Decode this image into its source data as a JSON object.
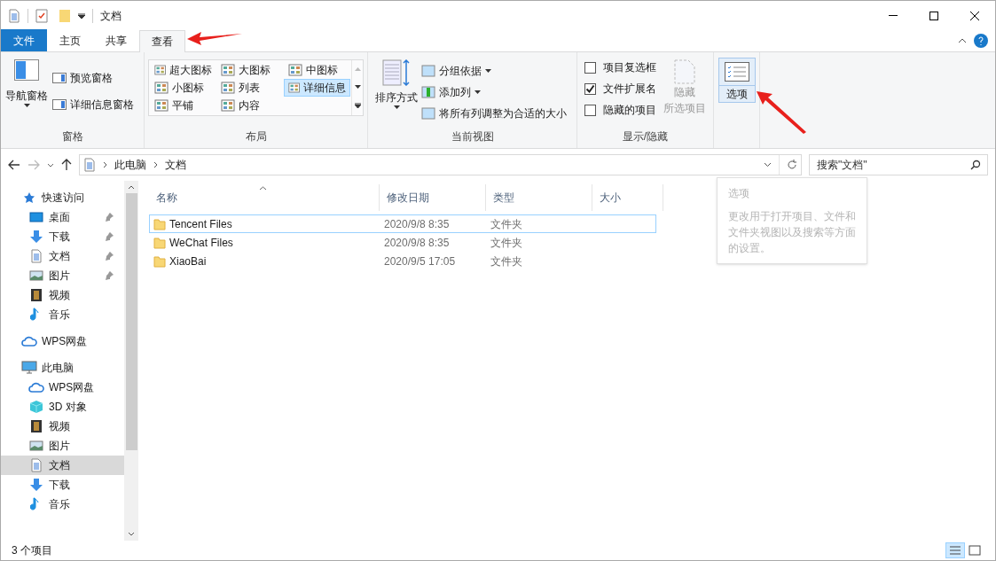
{
  "window": {
    "title": "文档"
  },
  "tabs": [
    {
      "label": "文件",
      "kind": "file",
      "selected": false
    },
    {
      "label": "主页",
      "kind": "tab",
      "selected": false
    },
    {
      "label": "共享",
      "kind": "tab",
      "selected": false
    },
    {
      "label": "查看",
      "kind": "tab",
      "selected": true
    }
  ],
  "ribbon": {
    "pane": {
      "label": "窗格",
      "nav_pane": "导航窗格",
      "items": [
        "预览窗格",
        "详细信息窗格"
      ]
    },
    "layout": {
      "label": "布局",
      "options": [
        {
          "label": "超大图标",
          "selected": false
        },
        {
          "label": "大图标",
          "selected": false
        },
        {
          "label": "中图标",
          "selected": false
        },
        {
          "label": "小图标",
          "selected": false
        },
        {
          "label": "列表",
          "selected": false
        },
        {
          "label": "详细信息",
          "selected": true
        },
        {
          "label": "平铺",
          "selected": false
        },
        {
          "label": "内容",
          "selected": false
        }
      ]
    },
    "current_view": {
      "label": "当前视图",
      "sort": "排序方式",
      "items": [
        {
          "label": "分组依据",
          "dropdown": true
        },
        {
          "label": "添加列",
          "dropdown": true
        },
        {
          "label": "将所有列调整为合适的大小",
          "dropdown": false
        }
      ]
    },
    "show_hide": {
      "label": "显示/隐藏",
      "checkboxes": [
        {
          "label": "项目复选框",
          "checked": false
        },
        {
          "label": "文件扩展名",
          "checked": true
        },
        {
          "label": "隐藏的项目",
          "checked": false
        }
      ],
      "hide_selected": {
        "line_1": "隐藏",
        "line_2": "所选项目",
        "disabled": true
      }
    },
    "options": {
      "label": "选项",
      "selected": true
    }
  },
  "address": {
    "path": [
      "此电脑",
      "文档"
    ],
    "search_placeholder": "搜索\"文档\""
  },
  "tooltip": {
    "title": "选项",
    "text": "更改用于打开项目、文件和文件夹视图以及搜索等方面的设置。"
  },
  "nav": [
    {
      "label": "快速访问",
      "kind": "star",
      "selected": false,
      "children": [
        {
          "label": "桌面",
          "kind": "desktop",
          "pinned": true,
          "selected": false
        },
        {
          "label": "下载",
          "kind": "download",
          "pinned": true,
          "selected": false
        },
        {
          "label": "文档",
          "kind": "document",
          "pinned": true,
          "selected": false
        },
        {
          "label": "图片",
          "kind": "picture",
          "pinned": true,
          "selected": false
        },
        {
          "label": "视频",
          "kind": "video",
          "pinned": false,
          "selected": false
        },
        {
          "label": "音乐",
          "kind": "music",
          "pinned": false,
          "selected": false
        }
      ]
    },
    {
      "label": "WPS网盘",
      "kind": "cloud",
      "selected": false
    },
    {
      "label": "此电脑",
      "kind": "pc",
      "selected": false,
      "children": [
        {
          "label": "WPS网盘",
          "kind": "cloud",
          "pinned": false,
          "selected": false
        },
        {
          "label": "3D 对象",
          "kind": "cube",
          "pinned": false,
          "selected": false
        },
        {
          "label": "视频",
          "kind": "video",
          "pinned": false,
          "selected": false
        },
        {
          "label": "图片",
          "kind": "picture",
          "pinned": false,
          "selected": false
        },
        {
          "label": "文档",
          "kind": "document",
          "pinned": false,
          "selected": true
        },
        {
          "label": "下载",
          "kind": "download",
          "pinned": false,
          "selected": false
        },
        {
          "label": "音乐",
          "kind": "music",
          "pinned": false,
          "selected": false
        }
      ]
    }
  ],
  "table": {
    "columns": [
      "名称",
      "修改日期",
      "类型",
      "大小"
    ],
    "rows": [
      {
        "name": "Tencent Files",
        "date": "2020/9/8 8:35",
        "type": "文件夹",
        "selected": true
      },
      {
        "name": "WeChat Files",
        "date": "2020/9/8 8:35",
        "type": "文件夹",
        "selected": false
      },
      {
        "name": "XiaoBai",
        "date": "2020/9/5 17:05",
        "type": "文件夹",
        "selected": false
      }
    ]
  },
  "status_bar": {
    "count": "3 个项目",
    "views": [
      {
        "kind": "details",
        "selected": true
      },
      {
        "kind": "large",
        "selected": false
      }
    ]
  }
}
